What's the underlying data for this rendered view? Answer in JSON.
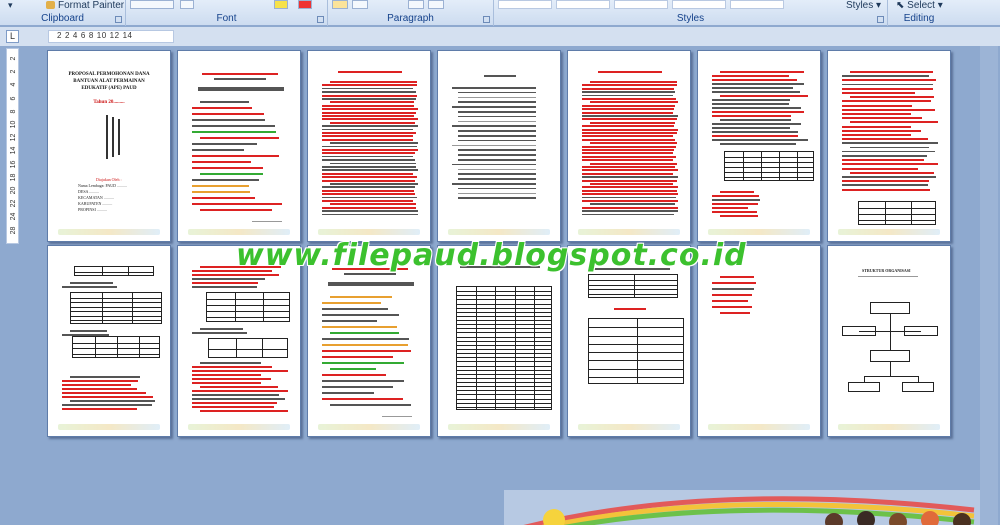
{
  "ribbon": {
    "clipboard": {
      "format_painter_label": "Format Painter",
      "group_label": "Clipboard"
    },
    "font": {
      "group_label": "Font"
    },
    "paragraph": {
      "group_label": "Paragraph"
    },
    "styles": {
      "styles_button_label": "Styles",
      "group_label": "Styles"
    },
    "editing": {
      "select_label": "Select",
      "group_label": "Editing"
    }
  },
  "ruler": {
    "tab_selector": "L",
    "horizontal_numbers": [
      "2",
      "2",
      "4",
      "6",
      "8",
      "10",
      "12",
      "14"
    ],
    "vertical_numbers": [
      "2",
      "2",
      "4",
      "6",
      "8",
      "10",
      "12",
      "14",
      "16",
      "18",
      "20",
      "22",
      "24",
      "28"
    ]
  },
  "pages": [
    {
      "kind": "cover",
      "cover_title": "PROPOSAL PERMOHONAN DANA BANTUAN ALAT PERMAINAN EDUKATIF (APE) PAUD",
      "cover_year": "Tahun 20.........",
      "cover_lines": [
        "Diajukan Oleh :",
        "Nama Lembaga: PAUD ..........",
        "DESA ..........",
        "KECAMATAN ..........",
        "KABUPATEN ..........",
        "PROPINSI .........."
      ]
    },
    {
      "kind": "letter"
    },
    {
      "kind": "text"
    },
    {
      "kind": "toc"
    },
    {
      "kind": "text-red"
    },
    {
      "kind": "text-table"
    },
    {
      "kind": "list-table"
    },
    {
      "kind": "tables"
    },
    {
      "kind": "form-tables"
    },
    {
      "kind": "letter2"
    },
    {
      "kind": "big-table"
    },
    {
      "kind": "schedule"
    },
    {
      "kind": "short-list"
    },
    {
      "kind": "org-chart",
      "org_title": "STRUKTUR ORGANISASI"
    }
  ],
  "watermark": {
    "text": "www.filepaud.blogspot.co.id"
  },
  "colors": {
    "workspace": "#8ea9cf",
    "ribbon": "#dbe6f4",
    "accent_text": "#15428b",
    "watermark": "#3cc12e",
    "error_underline": "#d22"
  }
}
